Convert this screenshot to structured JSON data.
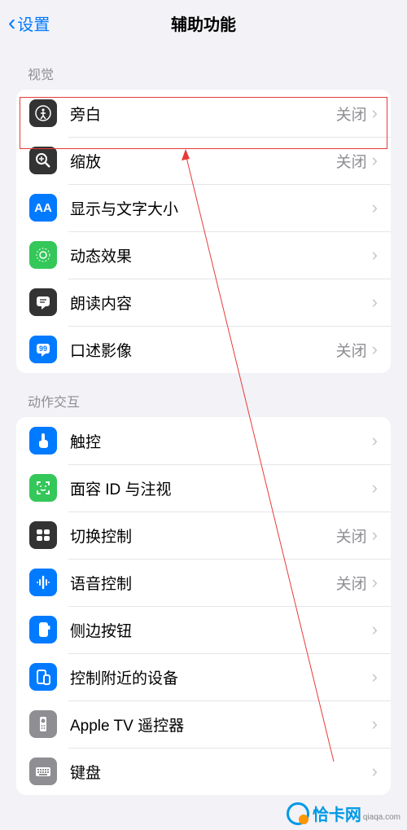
{
  "nav": {
    "back_label": "设置",
    "title": "辅助功能"
  },
  "sections": {
    "vision": {
      "header": "视觉",
      "items": [
        {
          "label": "旁白",
          "status": "关闭"
        },
        {
          "label": "缩放",
          "status": "关闭"
        },
        {
          "label": "显示与文字大小",
          "status": ""
        },
        {
          "label": "动态效果",
          "status": ""
        },
        {
          "label": "朗读内容",
          "status": ""
        },
        {
          "label": "口述影像",
          "status": "关闭"
        }
      ]
    },
    "interaction": {
      "header": "动作交互",
      "items": [
        {
          "label": "触控",
          "status": ""
        },
        {
          "label": "面容 ID 与注视",
          "status": ""
        },
        {
          "label": "切换控制",
          "status": "关闭"
        },
        {
          "label": "语音控制",
          "status": "关闭"
        },
        {
          "label": "侧边按钮",
          "status": ""
        },
        {
          "label": "控制附近的设备",
          "status": ""
        },
        {
          "label": "Apple TV 遥控器",
          "status": ""
        },
        {
          "label": "键盘",
          "status": ""
        }
      ]
    }
  },
  "watermark": {
    "cn": "恰卡网",
    "site": "qiaqa.com"
  }
}
